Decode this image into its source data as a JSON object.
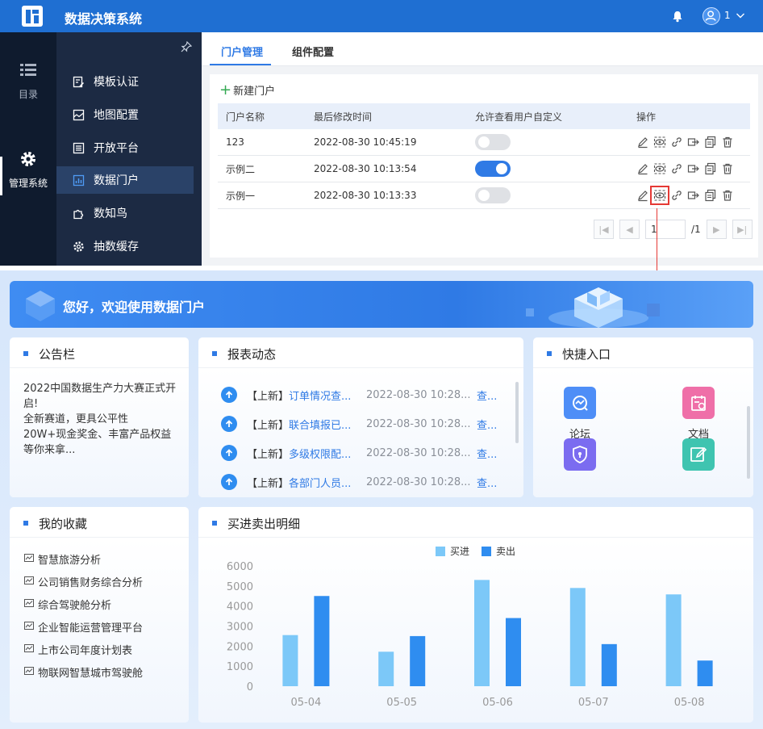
{
  "app": {
    "title": "数据决策系统",
    "user": "1"
  },
  "rail": {
    "catalog": "目录",
    "admin": "管理系统"
  },
  "menu": [
    {
      "label": "模板认证",
      "icon": "template-cert-icon"
    },
    {
      "label": "地图配置",
      "icon": "map-config-icon"
    },
    {
      "label": "开放平台",
      "icon": "open-platform-icon"
    },
    {
      "label": "数据门户",
      "icon": "data-portal-icon",
      "active": true
    },
    {
      "label": "数知鸟",
      "icon": "puzzle-icon"
    },
    {
      "label": "抽数缓存",
      "icon": "gear-cache-icon"
    }
  ],
  "tabs": [
    {
      "label": "门户管理",
      "active": true
    },
    {
      "label": "组件配置"
    }
  ],
  "portal_mgmt": {
    "new_button": "新建门户",
    "columns": [
      "门户名称",
      "最后修改时间",
      "允许查看用户自定义",
      "操作"
    ],
    "rows": [
      {
        "name": "123",
        "modified": "2022-08-30 10:45:19",
        "allow_custom": false
      },
      {
        "name": "示例二",
        "modified": "2022-08-30 10:13:54",
        "allow_custom": true
      },
      {
        "name": "示例一",
        "modified": "2022-08-30 10:13:33",
        "allow_custom": false
      }
    ],
    "pager": {
      "current": "1",
      "total": "/1"
    }
  },
  "portal": {
    "banner": "您好，欢迎使用数据门户",
    "notice": {
      "title": "公告栏",
      "text": "2022中国数据生产力大赛正式开启!\n全新赛道，更具公平性\n20W+现金奖金、丰富产品权益等你来拿..."
    },
    "reports": {
      "title": "报表动态",
      "items": [
        {
          "tag": "【上新】",
          "name": "订单情况查...",
          "time": "2022-08-30 10:28...",
          "link": "查..."
        },
        {
          "tag": "【上新】",
          "name": "联合填报已...",
          "time": "2022-08-30 10:28...",
          "link": "查..."
        },
        {
          "tag": "【上新】",
          "name": "多级权限配...",
          "time": "2022-08-30 10:28...",
          "link": "查..."
        },
        {
          "tag": "【上新】",
          "name": "各部门人员...",
          "time": "2022-08-30 10:28...",
          "link": "查..."
        }
      ]
    },
    "quick": {
      "title": "快捷入口",
      "items": [
        {
          "label": "论坛",
          "color": "#4e8ef7",
          "icon": "forum-icon"
        },
        {
          "label": "文档",
          "color": "#ef6fa8",
          "icon": "document-icon"
        },
        {
          "label": "",
          "color": "#7b6cf0",
          "icon": "shield-lock-icon"
        },
        {
          "label": "",
          "color": "#3fc4b0",
          "icon": "edit-icon"
        }
      ]
    },
    "favorites": {
      "title": "我的收藏",
      "items": [
        "智慧旅游分析",
        "公司销售财务综合分析",
        "综合驾驶舱分析",
        "企业智能运营管理平台",
        "上市公司年度计划表",
        "物联网智慧城市驾驶舱"
      ]
    },
    "chart_title": "买进卖出明细"
  },
  "chart_data": {
    "type": "bar",
    "title": "",
    "categories": [
      "05-04",
      "05-05",
      "05-06",
      "05-07",
      "05-08"
    ],
    "series": [
      {
        "name": "买进",
        "color": "#7cc8f8",
        "values": [
          2550,
          1720,
          5300,
          4900,
          4580
        ]
      },
      {
        "name": "卖出",
        "color": "#2f8df0",
        "values": [
          4500,
          2500,
          3400,
          2100,
          1280
        ]
      }
    ],
    "ylim": [
      0,
      6000
    ],
    "yticks": [
      0,
      1000,
      2000,
      3000,
      4000,
      5000,
      6000
    ],
    "legend": "top-center",
    "grid": false
  }
}
